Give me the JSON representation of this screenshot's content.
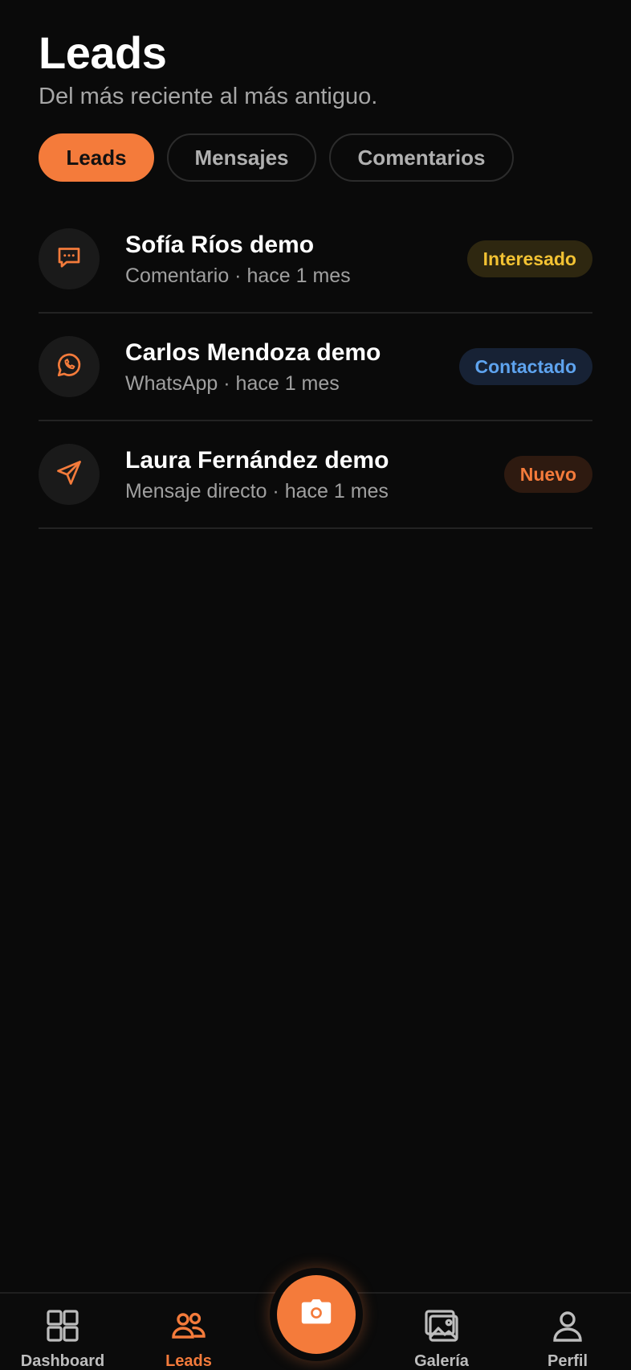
{
  "header": {
    "title": "Leads",
    "subtitle": "Del más reciente al más antiguo."
  },
  "tabs": [
    {
      "label": "Leads",
      "active": true
    },
    {
      "label": "Mensajes",
      "active": false
    },
    {
      "label": "Comentarios",
      "active": false
    }
  ],
  "leads": [
    {
      "name": "Sofía Ríos demo",
      "meta": "Comentario · hace 1 mes",
      "status": "Interesado",
      "icon": "comment-icon",
      "status_color": "#f2c233"
    },
    {
      "name": "Carlos Mendoza demo",
      "meta": "WhatsApp · hace 1 mes",
      "status": "Contactado",
      "icon": "whatsapp-icon",
      "status_color": "#5ea3ee"
    },
    {
      "name": "Laura Fernández demo",
      "meta": "Mensaje directo · hace 1 mes",
      "status": "Nuevo",
      "icon": "send-icon",
      "status_color": "#f47b3b"
    }
  ],
  "nav": {
    "dashboard": "Dashboard",
    "leads": "Leads",
    "camera_icon": "camera-icon",
    "gallery": "Galería",
    "profile": "Perfil"
  },
  "colors": {
    "accent": "#f47b3b",
    "background": "#0a0a0a"
  }
}
